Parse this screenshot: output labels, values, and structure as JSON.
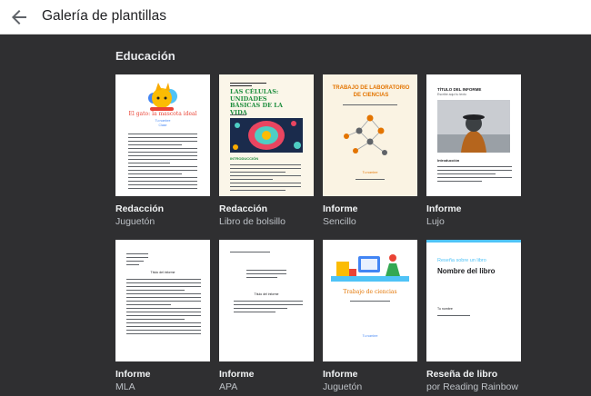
{
  "header": {
    "title": "Galería de plantillas",
    "back_icon": "arrow-back-icon"
  },
  "section": {
    "title": "Educación"
  },
  "templates": [
    {
      "category": "Redacción",
      "name": "Juguetón",
      "preview": {
        "title": "El gato: la mascota ideal",
        "author": "Tu nombre",
        "course": "Clase"
      }
    },
    {
      "category": "Redacción",
      "name": "Libro de bolsillo",
      "preview": {
        "title": "LAS CÉLULAS: UNIDADES BÁSICAS DE LA VIDA",
        "intro": "INTRODUCCIÓN"
      }
    },
    {
      "category": "Informe",
      "name": "Sencillo",
      "preview": {
        "title": "TRABAJO DE LABORATORIO DE CIENCIAS",
        "author": "Tu nombre"
      }
    },
    {
      "category": "Informe",
      "name": "Lujo",
      "preview": {
        "title": "TÍTULO DEL INFORME",
        "subtitle": "Escribe aquí tu texto",
        "intro": "Introducción"
      }
    },
    {
      "category": "Informe",
      "name": "MLA",
      "preview": {
        "title": "Título del informe"
      }
    },
    {
      "category": "Informe",
      "name": "APA",
      "preview": {
        "title": "Título del informe"
      }
    },
    {
      "category": "Informe",
      "name": "Juguetón",
      "preview": {
        "title": "Trabajo de ciencias",
        "author": "Tu nombre"
      }
    },
    {
      "category": "Reseña de libro",
      "name": "por Reading Rainbow",
      "preview": {
        "kicker": "Reseña sobre un libro",
        "title": "Nombre del libro",
        "author": "Tu nombre"
      }
    }
  ],
  "colors": {
    "background": "#2f2f31",
    "header_bg": "#ffffff",
    "playful_red": "#ea4335",
    "pocket_green": "#1e8e3e",
    "lab_orange": "#e37400",
    "review_blue": "#4fc3f7"
  }
}
